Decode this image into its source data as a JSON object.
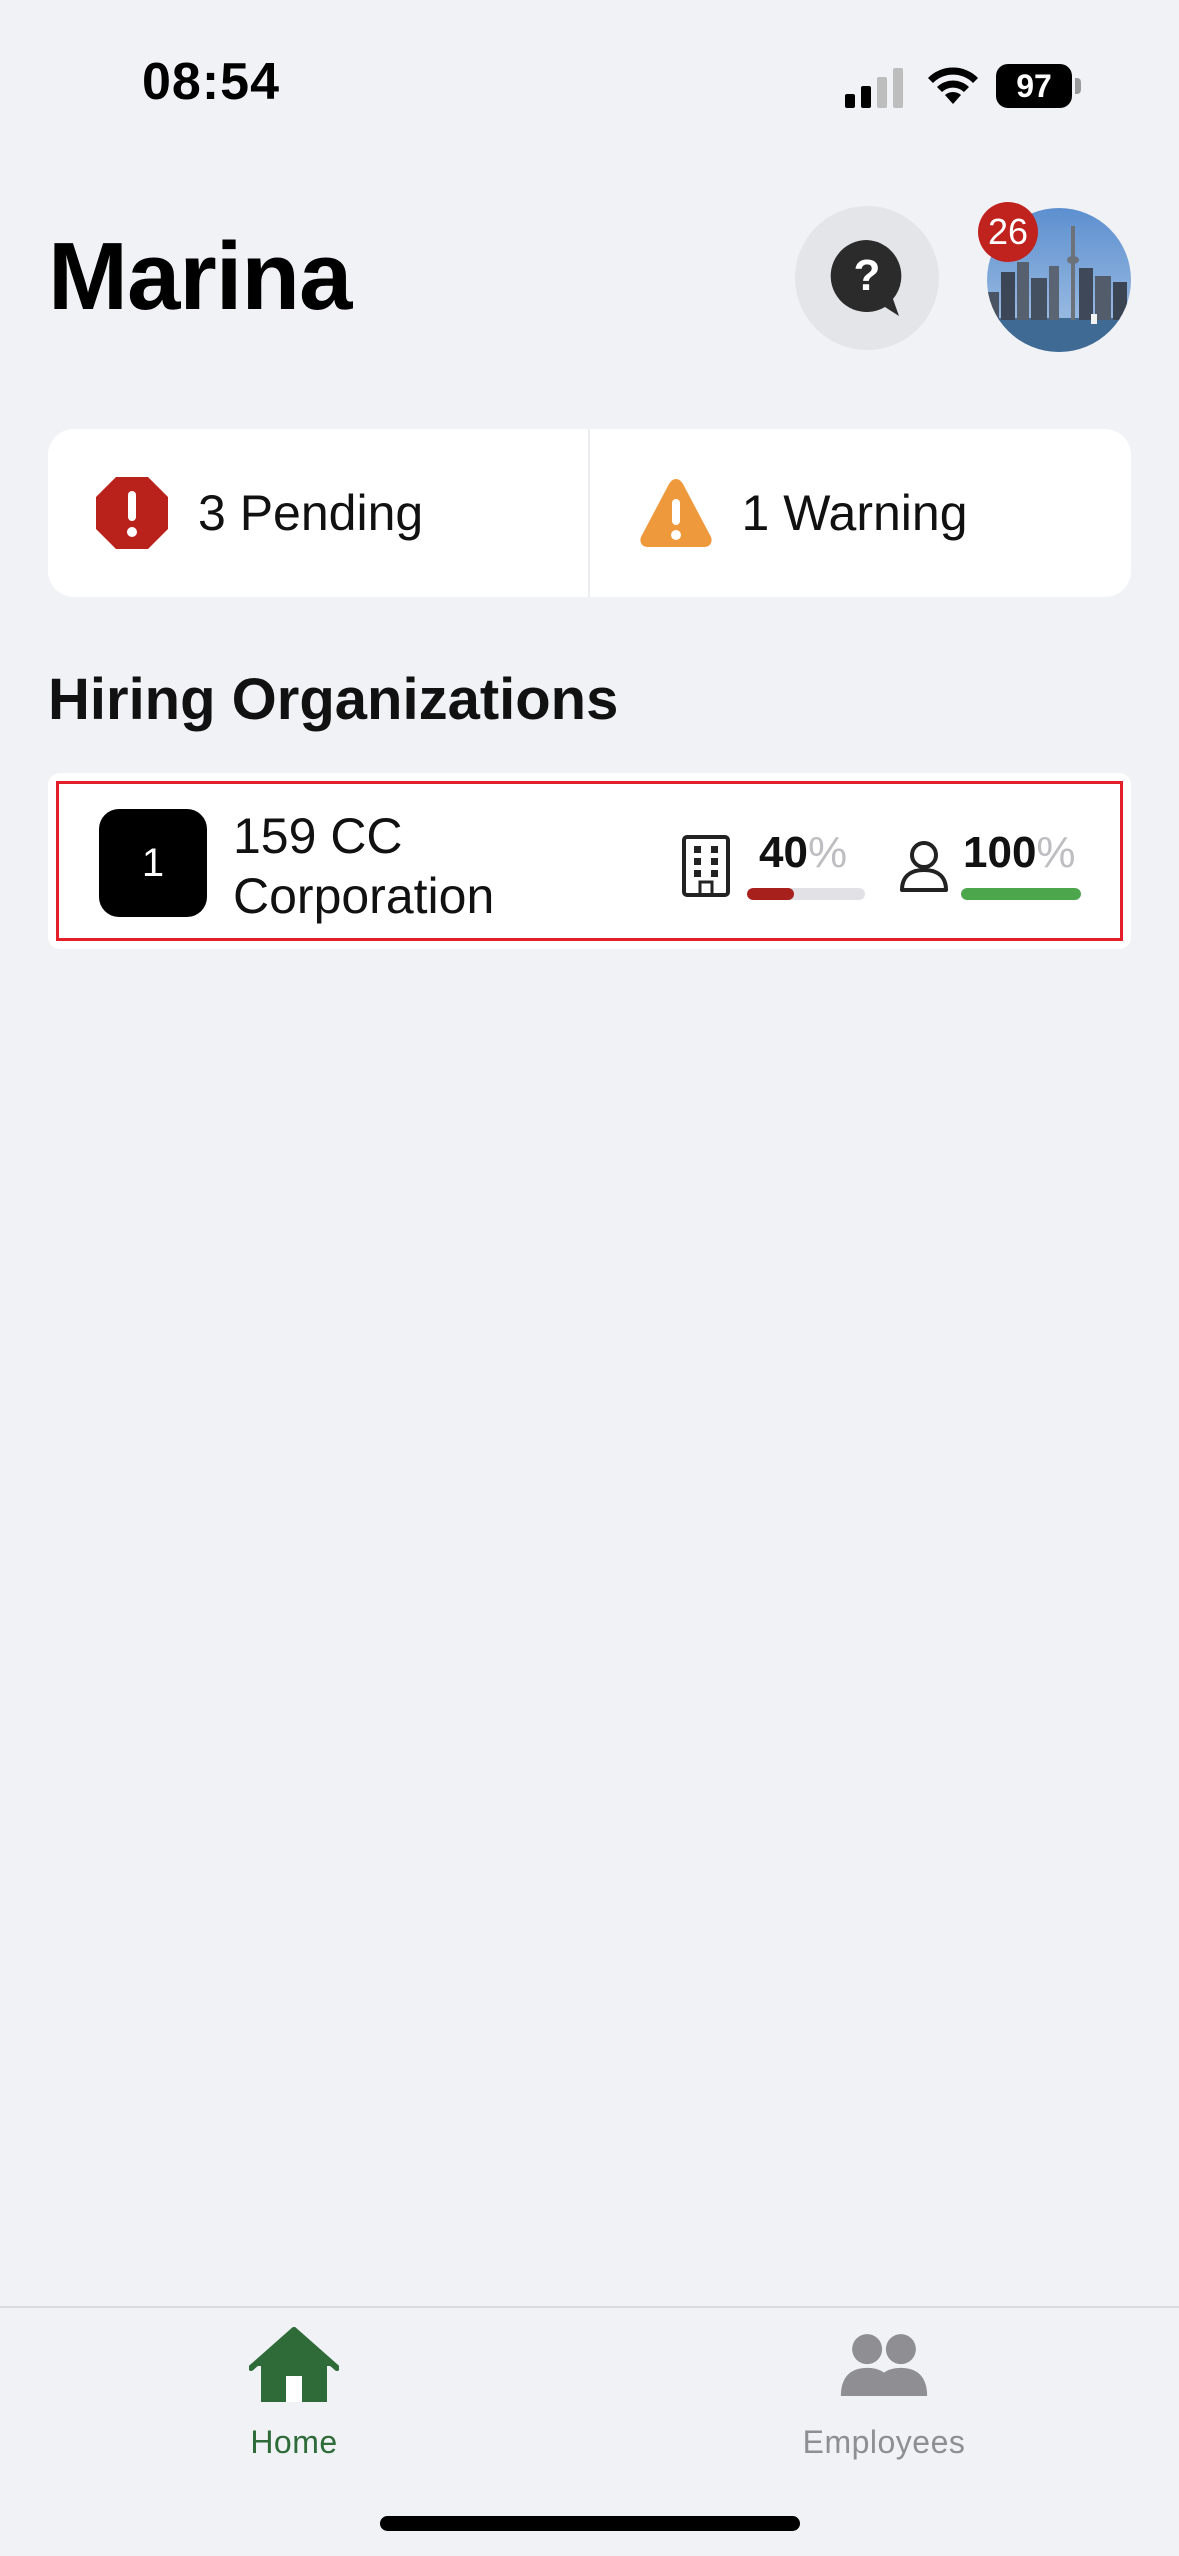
{
  "status_bar": {
    "time": "08:54",
    "battery": "97"
  },
  "header": {
    "title": "Marina",
    "notification_count": "26"
  },
  "summary": {
    "pending_label": "3 Pending",
    "warning_label": "1 Warning"
  },
  "section": {
    "title": "Hiring Organizations"
  },
  "organizations": [
    {
      "index": "1",
      "name": "159 CC Corporation",
      "building_pct_value": "40",
      "building_pct": 0.4,
      "employee_pct_value": "100",
      "employee_pct": 1.0,
      "pct_symbol": "%"
    }
  ],
  "tab_bar": {
    "tabs": [
      {
        "label": "Home",
        "icon": "house-icon",
        "active": true
      },
      {
        "label": "Employees",
        "icon": "people-icon",
        "active": false
      }
    ]
  },
  "colors": {
    "accent": "#2E6B38",
    "pending": "#B8221B",
    "warning": "#EE9A3C",
    "progress_low": "#A8201B",
    "progress_full": "#4CA64C",
    "inactive": "#8E8E93"
  }
}
